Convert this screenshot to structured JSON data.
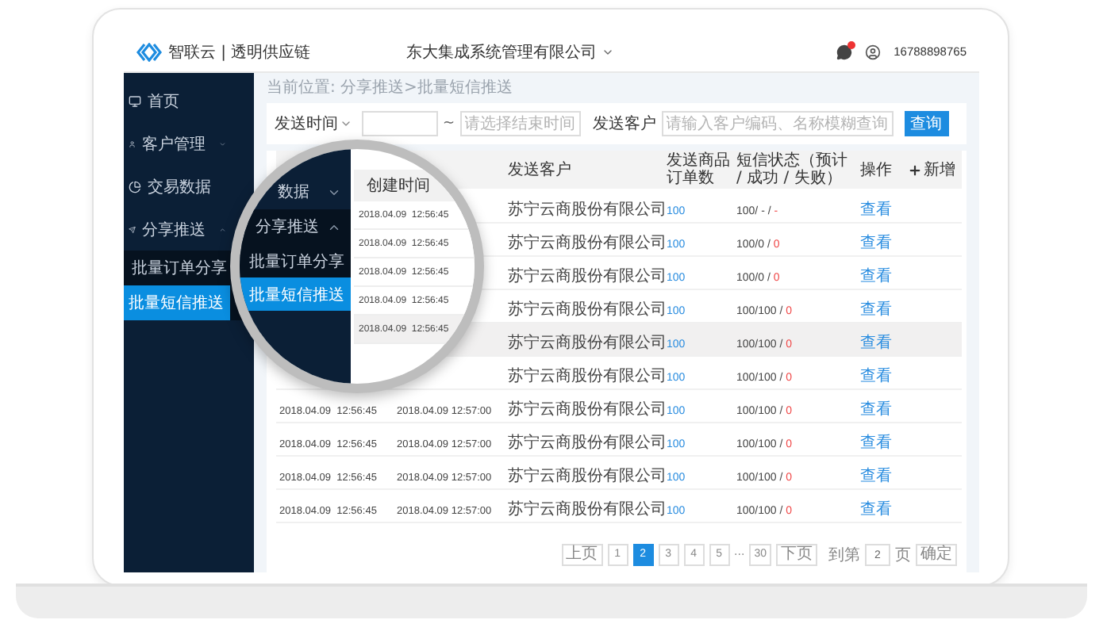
{
  "header": {
    "logo": "智联云 | 透明供应链",
    "company": "东大集成系统管理有限公司",
    "has_notification": true,
    "phone": "16788898765"
  },
  "sidebar": {
    "items": [
      {
        "label": "首页",
        "selected": false
      },
      {
        "label": "客户管理",
        "selected": false,
        "expanded": false
      },
      {
        "label": "交易数据",
        "selected": false
      },
      {
        "label": "分享推送",
        "selected": false,
        "expanded": true,
        "children": [
          {
            "label": "批量订单分享",
            "selected": false
          },
          {
            "label": "批量短信推送",
            "selected": true
          }
        ]
      }
    ]
  },
  "breadcrumb": "当前位置: 分享推送>批量短信推送",
  "filter": {
    "time_select": "发送时间",
    "range_separator": "~",
    "end_placeholder": "请选择结束时间",
    "customer_label": "发送客户",
    "customer_placeholder": "请输入客户编码、名称模糊查询",
    "search_button": "查询"
  },
  "table": {
    "columns": [
      {
        "label": "发送客户"
      },
      {
        "label": "发送商品订单数"
      },
      {
        "label": "短信状态（预计 / 成功 / 失败）"
      },
      {
        "label": "操作"
      }
    ],
    "add_button": "新增",
    "rows": [
      {
        "customer": "苏宁云商股份有限公司",
        "orders": "100",
        "status": "100/ - /",
        "failed": "-",
        "action": "查看",
        "highlighted": false
      },
      {
        "customer": "苏宁云商股份有限公司",
        "orders": "100",
        "status": "100/0 /",
        "failed": "0",
        "action": "查看",
        "highlighted": false
      },
      {
        "customer": "苏宁云商股份有限公司",
        "orders": "100",
        "status": "100/0 /",
        "failed": "0",
        "action": "查看",
        "highlighted": false
      },
      {
        "customer": "苏宁云商股份有限公司",
        "orders": "100",
        "status": "100/100 /",
        "failed": "0",
        "action": "查看",
        "highlighted": false
      },
      {
        "customer": "苏宁云商股份有限公司",
        "orders": "100",
        "status": "100/100 /",
        "failed": "0",
        "action": "查看",
        "highlighted": true
      },
      {
        "customer": "苏宁云商股份有限公司",
        "orders": "100",
        "status": "100/100 /",
        "failed": "0",
        "action": "查看",
        "highlighted": false
      },
      {
        "created": "2018.04.09  12:56:45",
        "sent": "2018.04.09 12:57:00",
        "customer": "苏宁云商股份有限公司",
        "orders": "100",
        "status": "100/100 /",
        "failed": "0",
        "action": "查看",
        "highlighted": false
      },
      {
        "created": "2018.04.09  12:56:45",
        "sent": "2018.04.09 12:57:00",
        "customer": "苏宁云商股份有限公司",
        "orders": "100",
        "status": "100/100 /",
        "failed": "0",
        "action": "查看",
        "highlighted": false
      },
      {
        "created": "2018.04.09  12:56:45",
        "sent": "2018.04.09 12:57:00",
        "customer": "苏宁云商股份有限公司",
        "orders": "100",
        "status": "100/100 /",
        "failed": "0",
        "action": "查看",
        "highlighted": false
      },
      {
        "created": "2018.04.09  12:56:45",
        "sent": "2018.04.09 12:57:00",
        "customer": "苏宁云商股份有限公司",
        "orders": "100",
        "status": "100/100 /",
        "failed": "0",
        "action": "查看",
        "highlighted": false
      }
    ]
  },
  "pagination": {
    "prev": "上页",
    "pages": [
      {
        "kind": "page",
        "label": "1",
        "selected": false
      },
      {
        "kind": "page",
        "label": "2",
        "selected": true
      },
      {
        "kind": "page",
        "label": "3",
        "selected": false
      },
      {
        "kind": "page",
        "label": "4",
        "selected": false
      },
      {
        "kind": "page",
        "label": "5",
        "selected": false
      },
      {
        "kind": "ellipsis",
        "label": "···"
      },
      {
        "kind": "page",
        "label": "30",
        "selected": false
      }
    ],
    "next": "下页",
    "goto_label": "到第",
    "goto_value": "2",
    "goto_unit": "页",
    "confirm": "确定"
  },
  "magnifier": {
    "sidebar_items": [
      {
        "kind": "parent",
        "label": "数据",
        "expanded": false,
        "selected": false
      },
      {
        "kind": "parent",
        "label": "分享推送",
        "expanded": true,
        "selected": false
      },
      {
        "kind": "child",
        "label": "批量订单分享",
        "selected": false
      },
      {
        "kind": "child",
        "label": "批量短信推送",
        "selected": true
      }
    ],
    "column_header": "创建时间",
    "times": [
      {
        "text": "2018.04.09  12:56:45",
        "highlighted": false
      },
      {
        "text": "2018.04.09  12:56:45",
        "highlighted": false
      },
      {
        "text": "2018.04.09  12:56:45",
        "highlighted": false
      },
      {
        "text": "2018.04.09  12:56:45",
        "highlighted": false
      },
      {
        "text": "2018.04.09  12:56:45",
        "highlighted": true
      }
    ]
  }
}
